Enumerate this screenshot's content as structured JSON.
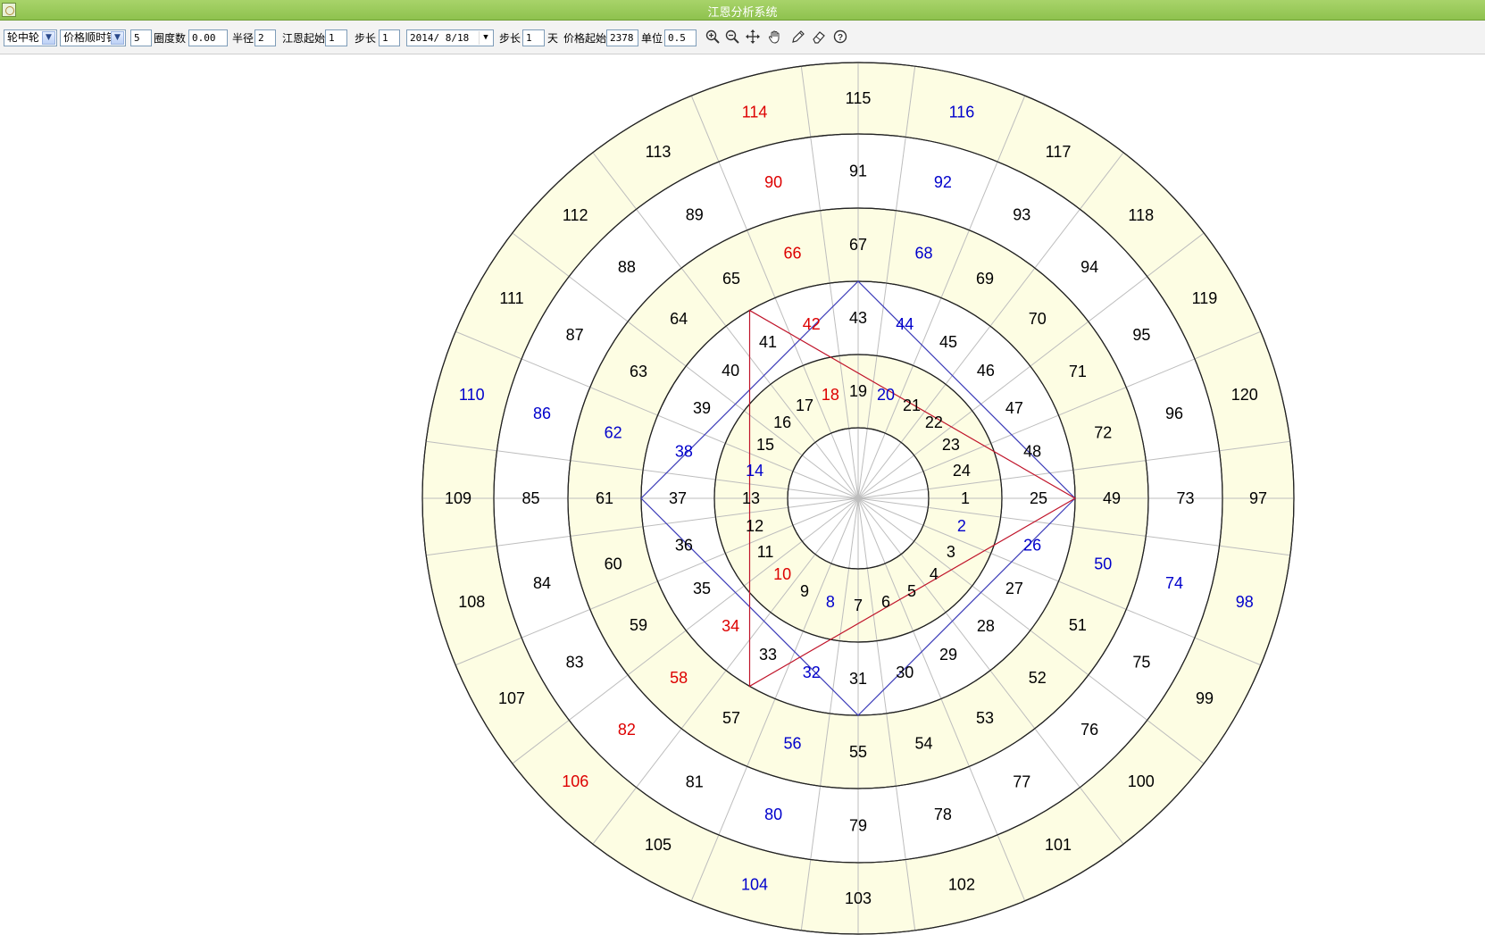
{
  "window": {
    "title": "江恩分析系统"
  },
  "toolbar": {
    "wheel_type": "轮中轮",
    "direction": "价格顺时针",
    "circle_count": "5",
    "degree_label": "圈度数",
    "degree_value": "0.00",
    "radius_label": "半径",
    "radius_value": "2",
    "gann_start_label": "江恩起始",
    "gann_start_value": "1",
    "step_label": "步长",
    "step_value": "1",
    "date_value": "2014/ 8/18",
    "step2_label": "步长",
    "step2_value": "1",
    "day_label": "天",
    "price_start_label": "价格起始",
    "price_start_value": "2378",
    "unit_label": "单位",
    "unit_value": "0.5",
    "tools": [
      "zoom-in-icon",
      "zoom-out-icon",
      "move-icon",
      "hand-icon",
      "pencil-icon",
      "eraser-icon",
      "help-icon"
    ]
  },
  "wheel": {
    "rings": [
      {
        "start": 1,
        "end": 24
      },
      {
        "start": 25,
        "end": 48
      },
      {
        "start": 49,
        "end": 72
      },
      {
        "start": 73,
        "end": 96
      },
      {
        "start": 97,
        "end": 120
      }
    ],
    "red_numbers": [
      10,
      18,
      34,
      42,
      58,
      66,
      82,
      90,
      106,
      114
    ],
    "blue_numbers": [
      2,
      8,
      14,
      20,
      26,
      32,
      38,
      44,
      50,
      56,
      62,
      68,
      74,
      80,
      86,
      92,
      98,
      104,
      110,
      116
    ],
    "colors": {
      "red": "#dd0000",
      "blue": "#0000cc",
      "normal": "#000000",
      "yellow_band": "#fdfde3",
      "white_band": "#ffffff",
      "spoke": "#bdbdbd",
      "square_line": "#3a3ab8",
      "triangle_line": "#c0142a"
    }
  }
}
